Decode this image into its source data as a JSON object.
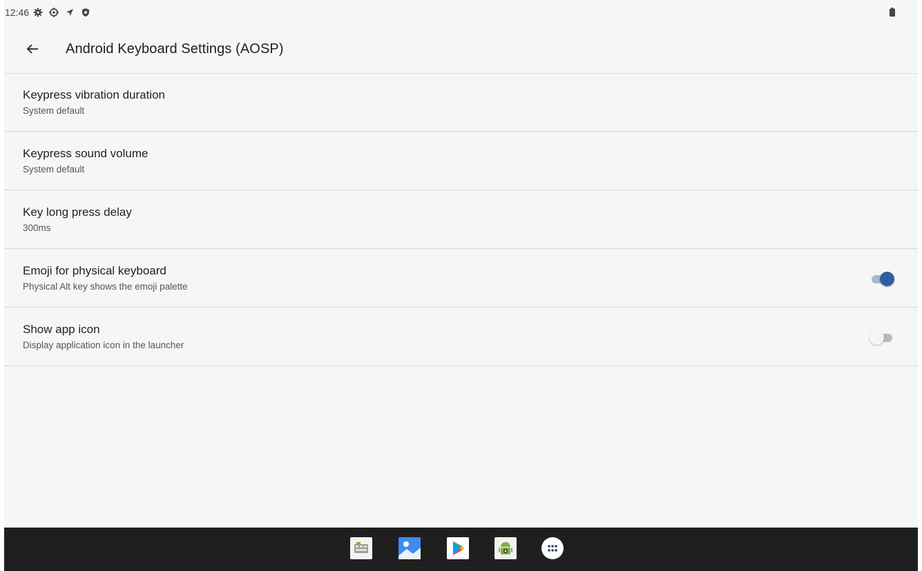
{
  "status_bar": {
    "time": "12:46",
    "icons": [
      "settings-gear-icon",
      "settings-cog-icon",
      "location-icon",
      "shield-icon"
    ],
    "battery_icon": "battery-icon"
  },
  "app_bar": {
    "back_icon": "arrow-back-icon",
    "title": "Android Keyboard Settings (AOSP)"
  },
  "preferences": [
    {
      "title": "Keypress vibration duration",
      "summary": "System default"
    },
    {
      "title": "Keypress sound volume",
      "summary": "System default"
    },
    {
      "title": "Key long press delay",
      "summary": "300ms"
    },
    {
      "title": "Emoji for physical keyboard",
      "summary": "Physical Alt key shows the emoji palette",
      "switch": "on"
    },
    {
      "title": "Show app icon",
      "summary": "Display application icon in the launcher",
      "switch": "off"
    }
  ],
  "taskbar": {
    "apps": [
      "keyboard-app-icon",
      "gallery-icon",
      "play-store-icon",
      "android-settings-icon",
      "app-drawer-icon"
    ]
  },
  "colors": {
    "accent": "#2f5f9e",
    "background": "#f6f6f6",
    "taskbar": "#1f1f1f"
  }
}
